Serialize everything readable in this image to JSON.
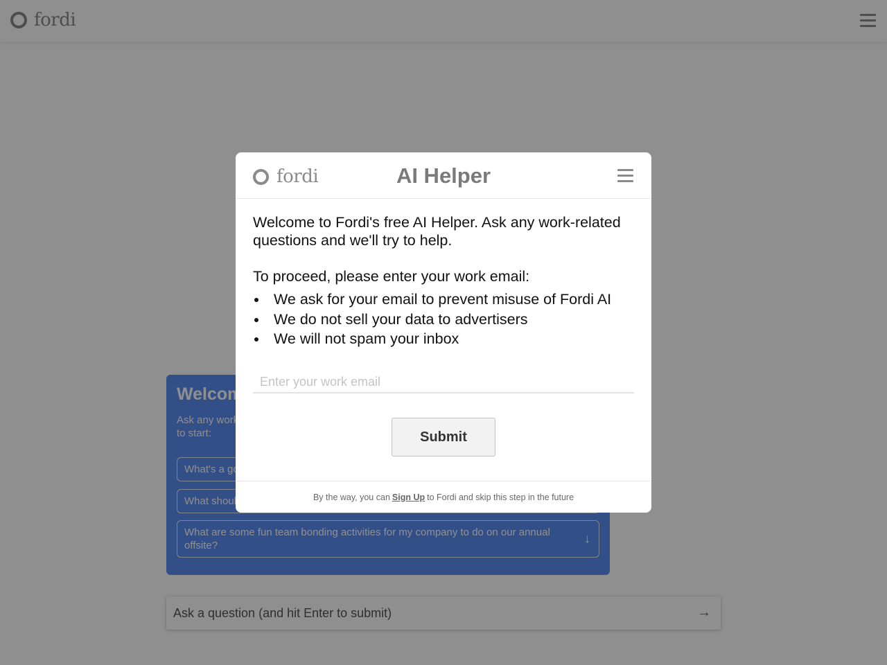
{
  "topbar": {
    "logo_text": "fordi",
    "menu_icon": "hamburger-icon"
  },
  "welcome_card": {
    "title": "Welcome",
    "subtitle": "Ask any work-related question, or choose a suggestion below to start:",
    "suggestions": [
      "What's a good way to...",
      "What should I...",
      "What are some fun team bonding activities for my company to do on our annual offsite?"
    ],
    "suggestion_icon": "arrow-down-icon",
    "accent_color": "#5b8ef0"
  },
  "ask": {
    "placeholder": "Ask a question (and hit Enter to submit)",
    "send_icon": "arrow-right-icon"
  },
  "modal": {
    "logo_text": "fordi",
    "title": "AI Helper",
    "menu_icon": "hamburger-icon",
    "intro": "Welcome to Fordi's free AI Helper. Ask any work-related questions and we'll try to help.",
    "proceed": "To proceed, please enter your work email:",
    "bullets": [
      "We ask for your email to prevent misuse of Fordi AI",
      "We do not sell your data to advertisers",
      "We will not spam your inbox"
    ],
    "email_placeholder": "Enter your work email",
    "submit_label": "Submit",
    "footer": {
      "before": "By the way, you can",
      "link": "Sign Up",
      "after": "to Fordi and skip this step in the future"
    }
  }
}
